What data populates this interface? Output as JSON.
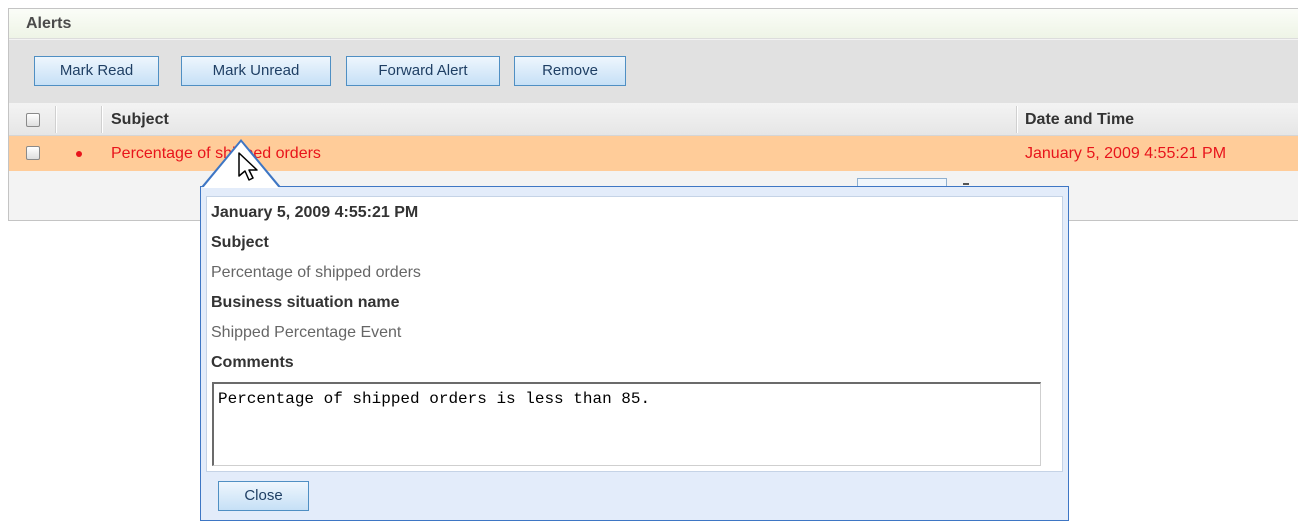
{
  "panel": {
    "title": "Alerts"
  },
  "toolbar": {
    "mark_read": "Mark Read",
    "mark_unread": "Mark Unread",
    "forward_alert": "Forward Alert",
    "remove": "Remove"
  },
  "table": {
    "columns": {
      "subject": "Subject",
      "date_time": "Date and Time"
    },
    "rows": [
      {
        "subject": "Percentage of shipped orders",
        "date_time": "January 5, 2009 4:55:21 PM",
        "unread": true
      }
    ]
  },
  "popup": {
    "date_time": "January 5, 2009 4:55:21 PM",
    "subject_label": "Subject",
    "subject_value": "Percentage of shipped orders",
    "situation_label": "Business situation name",
    "situation_value": "Shipped Percentage Event",
    "comments_label": "Comments",
    "comments_value": "Percentage of shipped orders is less than 85.",
    "close_label": "Close"
  },
  "colors": {
    "row_highlight": "#ffcc99",
    "unread_text": "#e8141b",
    "button_border": "#4f8fc3",
    "popup_border": "#3e76c4"
  },
  "icons": {
    "unread_marker": "red-dot-icon",
    "cursor": "mouse-pointer-icon"
  }
}
